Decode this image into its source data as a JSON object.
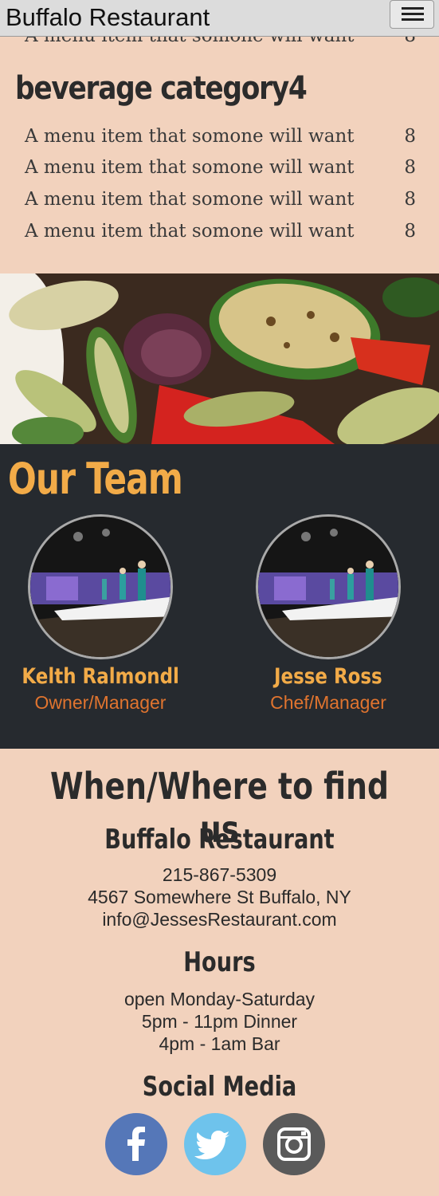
{
  "header": {
    "brand": "Buffalo Restaurant",
    "menu_icon": "hamburger-icon"
  },
  "menu": {
    "partial_item": {
      "name": "A menu item that somone will want",
      "price": "8"
    },
    "category": "beverage category4",
    "items": [
      {
        "name": "A menu item that somone will want",
        "price": "8"
      },
      {
        "name": "A menu item that somone will want",
        "price": "8"
      },
      {
        "name": "A menu item that somone will want",
        "price": "8"
      },
      {
        "name": "A menu item that somone will want",
        "price": "8"
      }
    ]
  },
  "team": {
    "title": "Our Team",
    "members": [
      {
        "name": "Kelth Ralmondl",
        "role": "Owner/Manager"
      },
      {
        "name": "Jesse Ross",
        "role": "Chef/Manager"
      }
    ]
  },
  "contact": {
    "title": "When/Where to find us",
    "business": "Buffalo Restaurant",
    "phone": "215-867-5309",
    "address": "4567 Somewhere St Buffalo, NY",
    "email": "info@JessesRestaurant.com",
    "hours_title": "Hours",
    "hours": [
      "open Monday-Saturday",
      "5pm - 11pm Dinner",
      "4pm - 1am Bar"
    ],
    "social_title": "Social Media",
    "social": [
      {
        "icon": "facebook-icon",
        "color": "#5577b8"
      },
      {
        "icon": "twitter-icon",
        "color": "#6ec3ec"
      },
      {
        "icon": "instagram-icon",
        "color": "#5a5a5a"
      }
    ]
  },
  "colors": {
    "accent": "#f2ab48",
    "role": "#e0742f",
    "dark": "#262a2f",
    "bg": "#f2d2bd"
  }
}
